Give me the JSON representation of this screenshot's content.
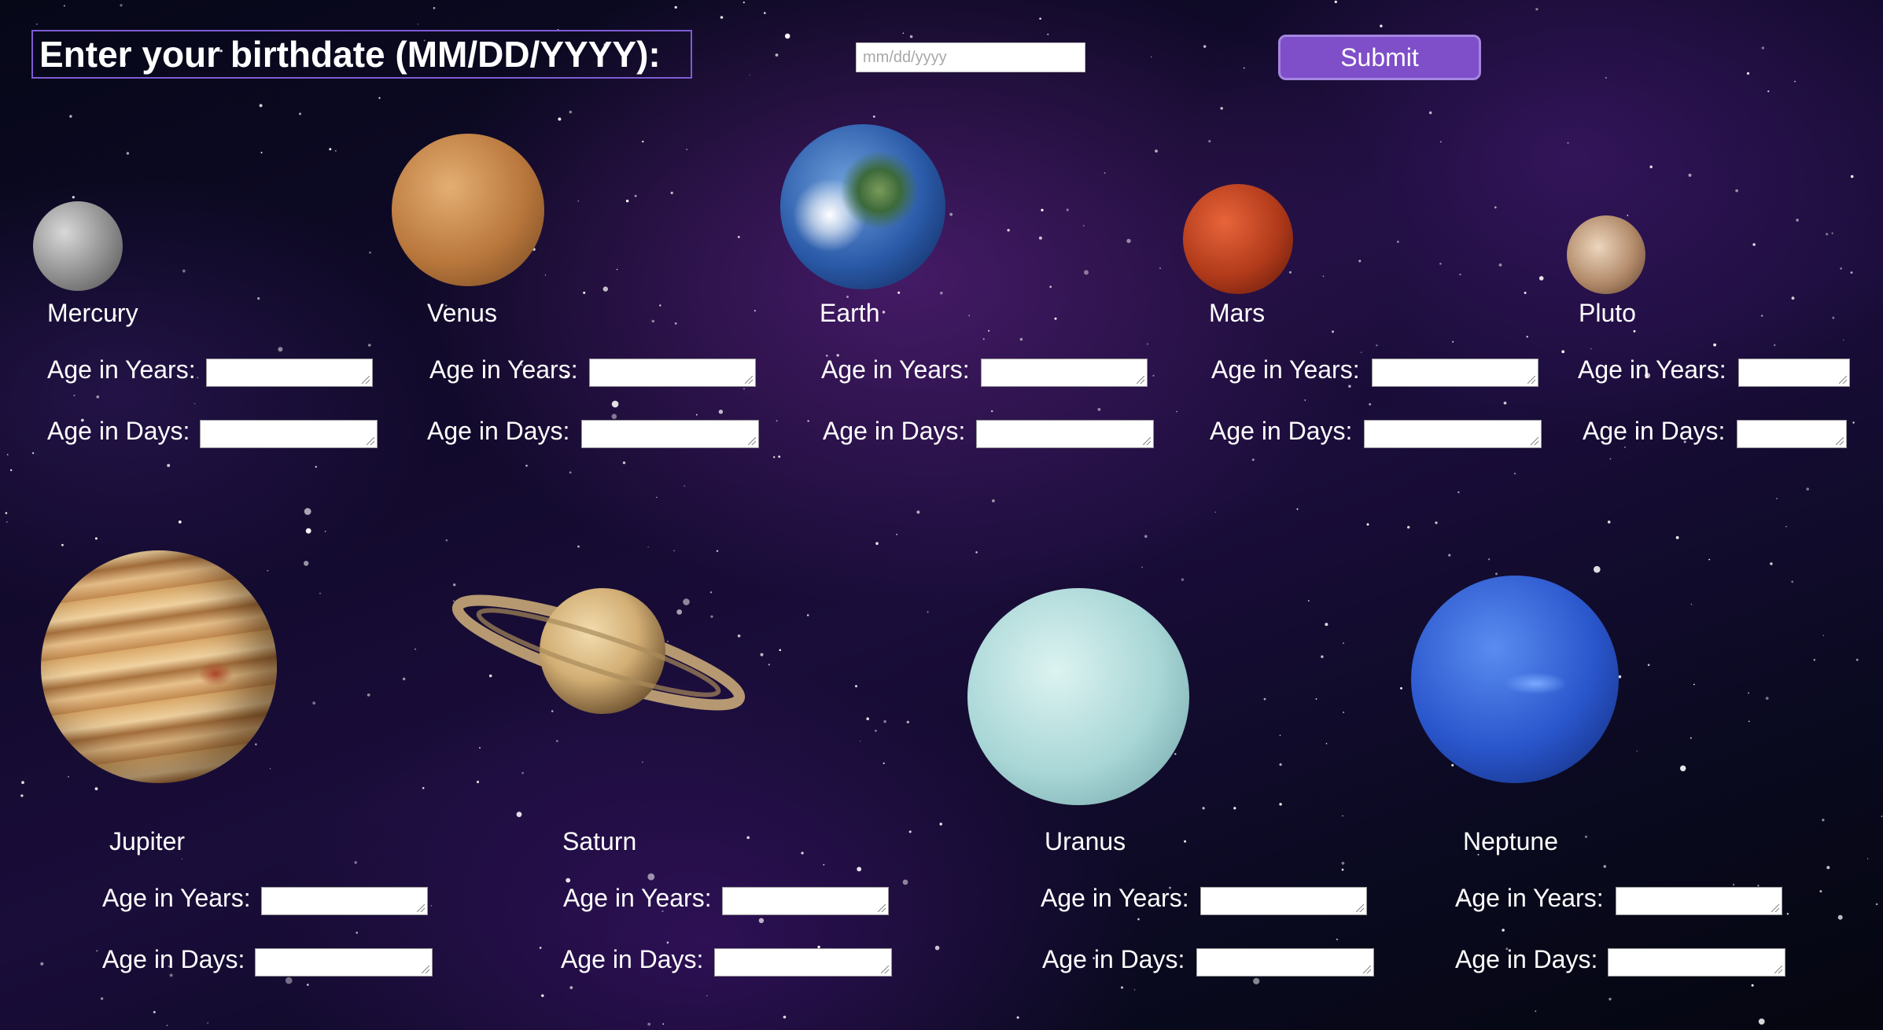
{
  "header": {
    "prompt_label": "Enter your birthdate (MM/DD/YYYY):",
    "date_placeholder": "mm/dd/yyyy",
    "submit_label": "Submit"
  },
  "fields": {
    "years_label": "Age in Years:",
    "days_label": "Age in Days:"
  },
  "planets": [
    {
      "name": "Mercury",
      "age_years": "",
      "age_days": ""
    },
    {
      "name": "Venus",
      "age_years": "",
      "age_days": ""
    },
    {
      "name": "Earth",
      "age_years": "",
      "age_days": ""
    },
    {
      "name": "Mars",
      "age_years": "",
      "age_days": ""
    },
    {
      "name": "Pluto",
      "age_years": "",
      "age_days": ""
    },
    {
      "name": "Jupiter",
      "age_years": "",
      "age_days": ""
    },
    {
      "name": "Saturn",
      "age_years": "",
      "age_days": ""
    },
    {
      "name": "Uranus",
      "age_years": "",
      "age_days": ""
    },
    {
      "name": "Neptune",
      "age_years": "",
      "age_days": ""
    }
  ],
  "colors": {
    "accent": "#7f4ec9",
    "label_border": "#7e5bd4",
    "background": "#120a2c"
  }
}
